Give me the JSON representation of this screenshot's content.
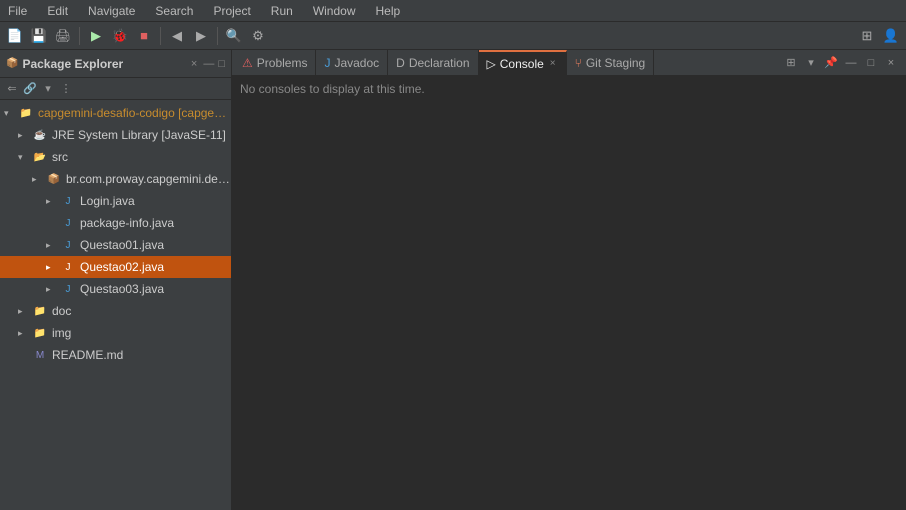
{
  "menu": {
    "items": [
      "File",
      "Edit",
      "Navigate",
      "Search",
      "Project",
      "Run",
      "Window",
      "Help"
    ]
  },
  "explorer": {
    "title": "Package Explorer",
    "close_label": "×",
    "tree": [
      {
        "indent": 0,
        "arrow": "▾",
        "icon": "project",
        "label": "capgemini-desafio-codigo [capgemini-desaf...",
        "type": "project"
      },
      {
        "indent": 1,
        "arrow": "▸",
        "icon": "jre",
        "label": "JRE System Library [JavaSE-11]",
        "type": "jre"
      },
      {
        "indent": 1,
        "arrow": "▾",
        "icon": "src",
        "label": "src",
        "type": "src"
      },
      {
        "indent": 2,
        "arrow": "▸",
        "icon": "pkg",
        "label": "br.com.proway.capgemini.desafioDeP...",
        "type": "pkg"
      },
      {
        "indent": 3,
        "arrow": "▸",
        "icon": "java",
        "label": "Login.java",
        "type": "java"
      },
      {
        "indent": 3,
        "arrow": "",
        "icon": "java",
        "label": "package-info.java",
        "type": "java"
      },
      {
        "indent": 3,
        "arrow": "▸",
        "icon": "java",
        "label": "Questao01.java",
        "type": "java"
      },
      {
        "indent": 3,
        "arrow": "▸",
        "icon": "java",
        "label": "Questao02.java",
        "type": "java",
        "selected": true
      },
      {
        "indent": 3,
        "arrow": "▸",
        "icon": "java",
        "label": "Questao03.java",
        "type": "java"
      },
      {
        "indent": 1,
        "arrow": "▸",
        "icon": "doc",
        "label": "doc",
        "type": "folder"
      },
      {
        "indent": 1,
        "arrow": "▸",
        "icon": "img",
        "label": "img",
        "type": "folder"
      },
      {
        "indent": 1,
        "arrow": "",
        "icon": "md",
        "label": "README.md",
        "type": "file"
      }
    ]
  },
  "tabs": {
    "items": [
      {
        "label": "Problems",
        "icon": "problems",
        "active": false,
        "closeable": false
      },
      {
        "label": "Javadoc",
        "icon": "javadoc",
        "active": false,
        "closeable": false
      },
      {
        "label": "Declaration",
        "icon": "declaration",
        "active": false,
        "closeable": false
      },
      {
        "label": "Console",
        "icon": "console",
        "active": true,
        "closeable": true
      },
      {
        "label": "Git Staging",
        "icon": "git",
        "active": false,
        "closeable": false
      }
    ]
  },
  "console": {
    "message": "No consoles to display at this time."
  }
}
